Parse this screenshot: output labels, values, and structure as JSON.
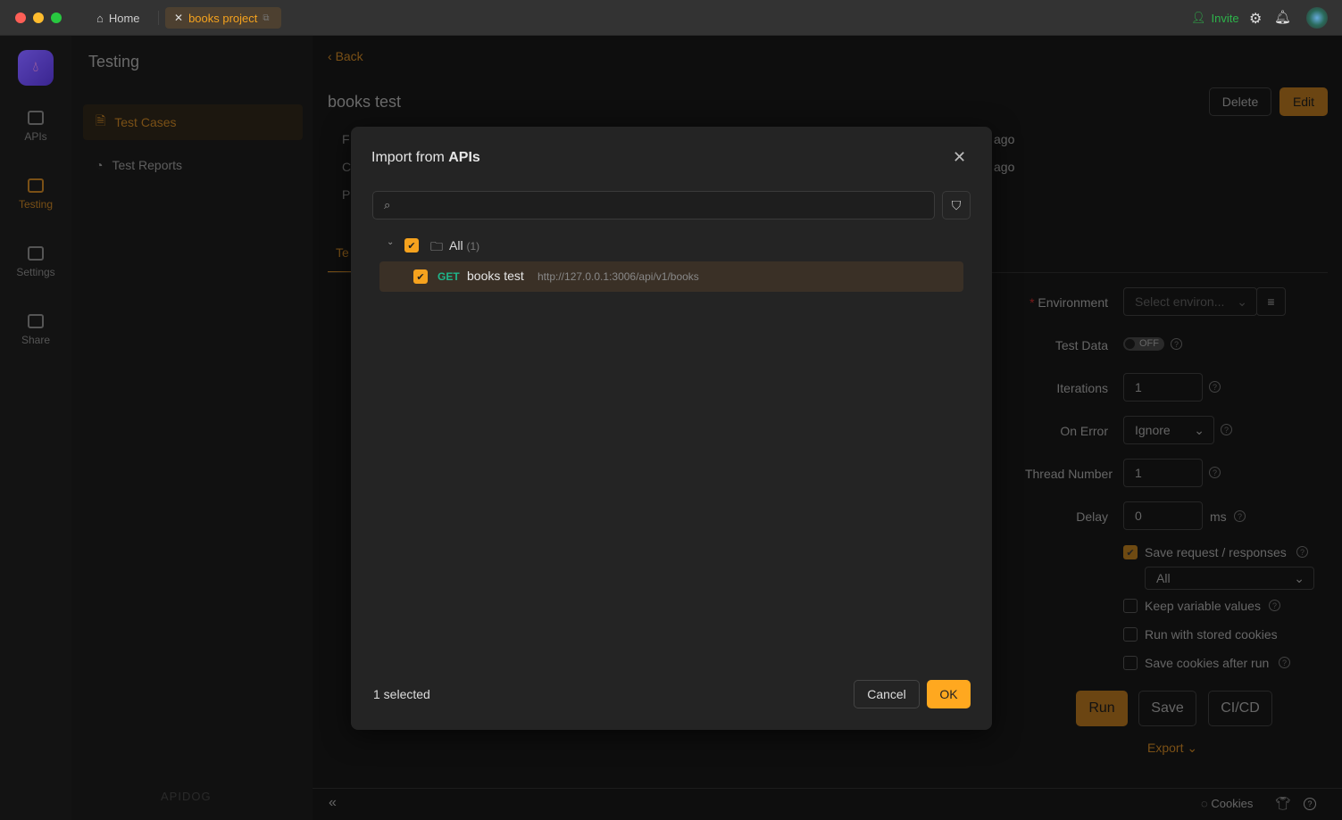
{
  "titlebar": {
    "home_label": "Home",
    "project_tab": "books project",
    "invite_label": "Invite"
  },
  "rail": {
    "items": [
      {
        "label": "APIs"
      },
      {
        "label": "Testing"
      },
      {
        "label": "Settings"
      },
      {
        "label": "Share"
      }
    ],
    "brand": "APIDOG"
  },
  "sidebar": {
    "title": "Testing",
    "items": [
      {
        "label": "Test Cases"
      },
      {
        "label": "Test Reports"
      }
    ]
  },
  "main": {
    "back": "Back",
    "title": "books test",
    "delete": "Delete",
    "edit": "Edit",
    "meta": [
      {
        "prefix": "F",
        "suffix": "ago"
      },
      {
        "prefix": "C",
        "suffix": "ago"
      },
      {
        "prefix": "P",
        "suffix": ""
      }
    ],
    "tab_prefix": "Te"
  },
  "form": {
    "environment_label": "Environment",
    "environment_placeholder": "Select environ...",
    "test_data_label": "Test Data",
    "test_data_toggle": "OFF",
    "iterations_label": "Iterations",
    "iterations_value": "1",
    "on_error_label": "On Error",
    "on_error_value": "Ignore",
    "thread_label": "Thread Number",
    "thread_value": "1",
    "delay_label": "Delay",
    "delay_value": "0",
    "delay_unit": "ms",
    "save_req_label": "Save request / responses",
    "save_req_option": "All",
    "keep_vars_label": "Keep variable values",
    "stored_cookies_label": "Run with stored cookies",
    "save_cookies_label": "Save cookies after run",
    "run": "Run",
    "save": "Save",
    "cicd": "CI/CD",
    "export": "Export"
  },
  "statusbar": {
    "cookies": "Cookies"
  },
  "modal": {
    "title_prefix": "Import from ",
    "title_bold": "APIs",
    "search_placeholder": "",
    "tree": {
      "root_label": "All",
      "root_count": "(1)",
      "items": [
        {
          "method": "GET",
          "name": "books test",
          "url": "http://127.0.0.1:3006/api/v1/books",
          "checked": true
        }
      ]
    },
    "selected_text": "1 selected",
    "cancel": "Cancel",
    "ok": "OK"
  },
  "colors": {
    "accent": "#f5a21e",
    "get_method": "#1fb58a",
    "invite": "#2db34a"
  }
}
